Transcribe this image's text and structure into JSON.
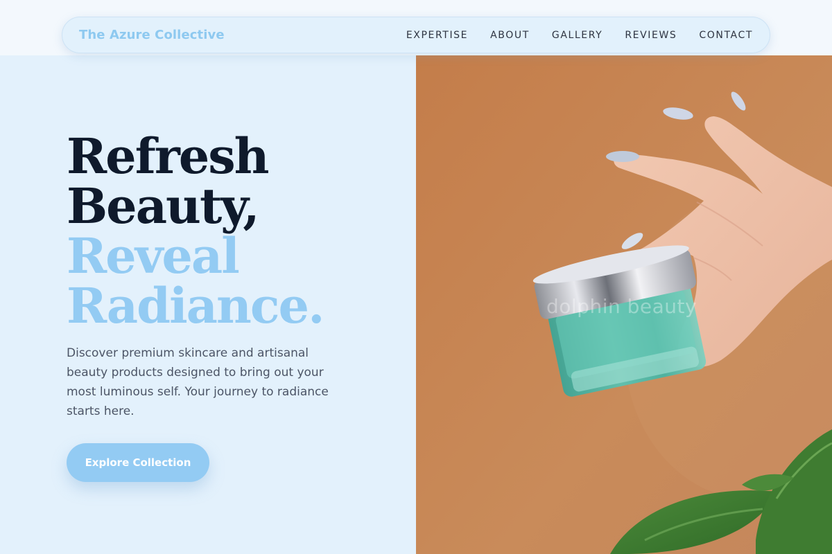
{
  "header": {
    "brand": "The Azure Collective",
    "nav": [
      "EXPERTISE",
      "ABOUT",
      "GALLERY",
      "REVIEWS",
      "CONTACT"
    ]
  },
  "hero": {
    "title_lines": [
      "Refresh",
      "Beauty,",
      "Reveal",
      "Radiance."
    ],
    "description": "Discover premium skincare and artisanal beauty products designed to bring out your most luminous self. Your journey to radiance starts here.",
    "cta_label": "Explore Collection"
  },
  "image": {
    "watermark": "dolphin beauty",
    "subject": "hand-holding-cream-jar"
  },
  "colors": {
    "accent": "#93cbf3",
    "headline_dark": "#0f1a2c",
    "panel_bg": "#e3f1fc",
    "photo_bg": "#c88350"
  }
}
